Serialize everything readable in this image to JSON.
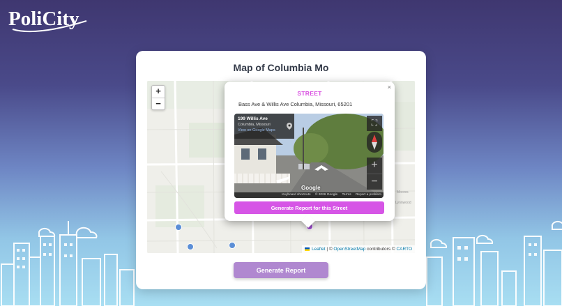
{
  "brand": {
    "logo_text": "PoliCity"
  },
  "card": {
    "title": "Map of Columbia Mo",
    "generate_label": "Generate Report"
  },
  "map": {
    "zoom_in": "+",
    "zoom_out": "−",
    "attribution": {
      "leaflet": "Leaflet",
      "sep1": " | © ",
      "osm": "OpenStreetMap",
      "mid": " contributors © ",
      "carto": "CARTO"
    },
    "marker_color": "#5b8ed6",
    "selected_marker_color": "#a04fd0"
  },
  "popup": {
    "close": "×",
    "heading": "STREET",
    "address": "Bass Ave & Willis Ave Columbia, Missouri, 65201",
    "button_label": "Generate Report for this Street",
    "streetview": {
      "street": "199 Willis Ave",
      "city": "Columbia, Missouri",
      "link": "View on Google Maps",
      "google": "Google",
      "footer": [
        "Keyboard shortcuts",
        "© 2026 Google",
        "Terms",
        "Report a problem"
      ]
    }
  },
  "colors": {
    "accent": "#d84fe0",
    "primary_button": "#b088d0"
  }
}
